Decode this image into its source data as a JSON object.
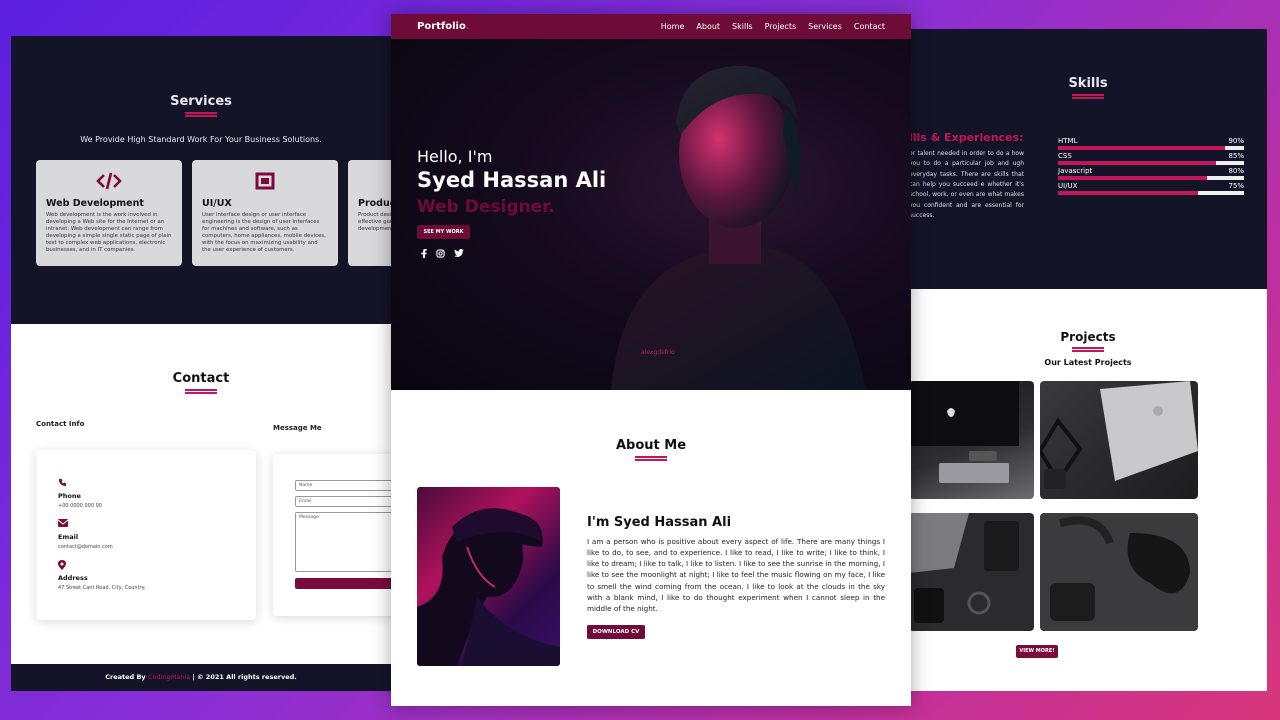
{
  "services": {
    "title": "Services",
    "subtitle": "We Provide High Standard Work For Your Business Solutions.",
    "cards": [
      {
        "icon": "code-icon",
        "title": "Web Development",
        "text": "Web development is the work involved in developing a Web site for the Internet or an intranet. Web development can range from developing a simple single static page of plain text to complex web applications, electronic businesses, and in IT companies."
      },
      {
        "icon": "crop-icon",
        "title": "UI/UX",
        "text": "User interface design or user interface engineering is the design of user interfaces for machines and software, such as computers, home appliances, mobile devices, with the focus on maximizing usability and the user experience of customers."
      },
      {
        "icon": "product-icon",
        "title": "Produc",
        "text": "Product desi product to be customers. A effective gen through a pr Thus, it is a n developmen"
      }
    ]
  },
  "contact": {
    "title": "Contact",
    "info_label": "Contact Info",
    "message_label": "Message Me",
    "phone_label": "Phone",
    "phone_value": "+00 0000 000 00",
    "email_label": "Email",
    "email_value": "contact@domain.com",
    "address_label": "Address",
    "address_value": "47 Street Cant Road, City, Country.",
    "name_placeholder": "Name",
    "email_placeholder": "Email",
    "message_placeholder": "Message"
  },
  "footer": {
    "created_by": "Created By",
    "brand": "CodingMania",
    "rights": "| © 2021 All rights reserved."
  },
  "nav": {
    "logo": "Portfolio",
    "logo_dot": ".",
    "links": [
      "Home",
      "About",
      "Skills",
      "Projects",
      "Services",
      "Contact"
    ]
  },
  "hero": {
    "greeting": "Hello, I'm",
    "name": "Syed Hassan Ali",
    "role": "Web Designer.",
    "cta": "SEE MY WORK",
    "watermark": "alexgdefrio"
  },
  "about": {
    "title": "About Me",
    "heading": "I'm Syed Hassan Ali",
    "text": "I am a person who is positive about every aspect of life. There are many things I like to do, to see, and to experience. I like to read, I like to write; I like to think, I like to dream; I like to talk, I like to listen. I like to see the sunrise in the morning, I like to see the moonlight at night; I like to feel the music flowing on my face, I like to smell the wind coming from the ocean. I like to look at the clouds in the sky with a blank mind, I like to do thought experiment when I cannot sleep in the middle of the night.",
    "cta": "DOWNLOAD CV"
  },
  "skills": {
    "title": "Skills",
    "heading": "ills & Experiences:",
    "text": "or talent needed in order to do a how you to do a particular job and ugh everyday tasks. There are skills that can help you succeed e whether it's school, work, or even are what makes you confident and are essential for success.",
    "items": [
      {
        "name": "HTML",
        "percent_label": "90%",
        "percent": 90
      },
      {
        "name": "CSS",
        "percent_label": "85%",
        "percent": 85
      },
      {
        "name": "Javascript",
        "percent_label": "80%",
        "percent": 80
      },
      {
        "name": "UI/UX",
        "percent_label": "75%",
        "percent": 75
      }
    ]
  },
  "projects": {
    "title": "Projects",
    "subtitle": "Our Latest Projects",
    "cta": "VIEW MORE!"
  },
  "colors": {
    "accent": "#c2185b",
    "brand": "#6e0b36",
    "dark": "#141429"
  }
}
